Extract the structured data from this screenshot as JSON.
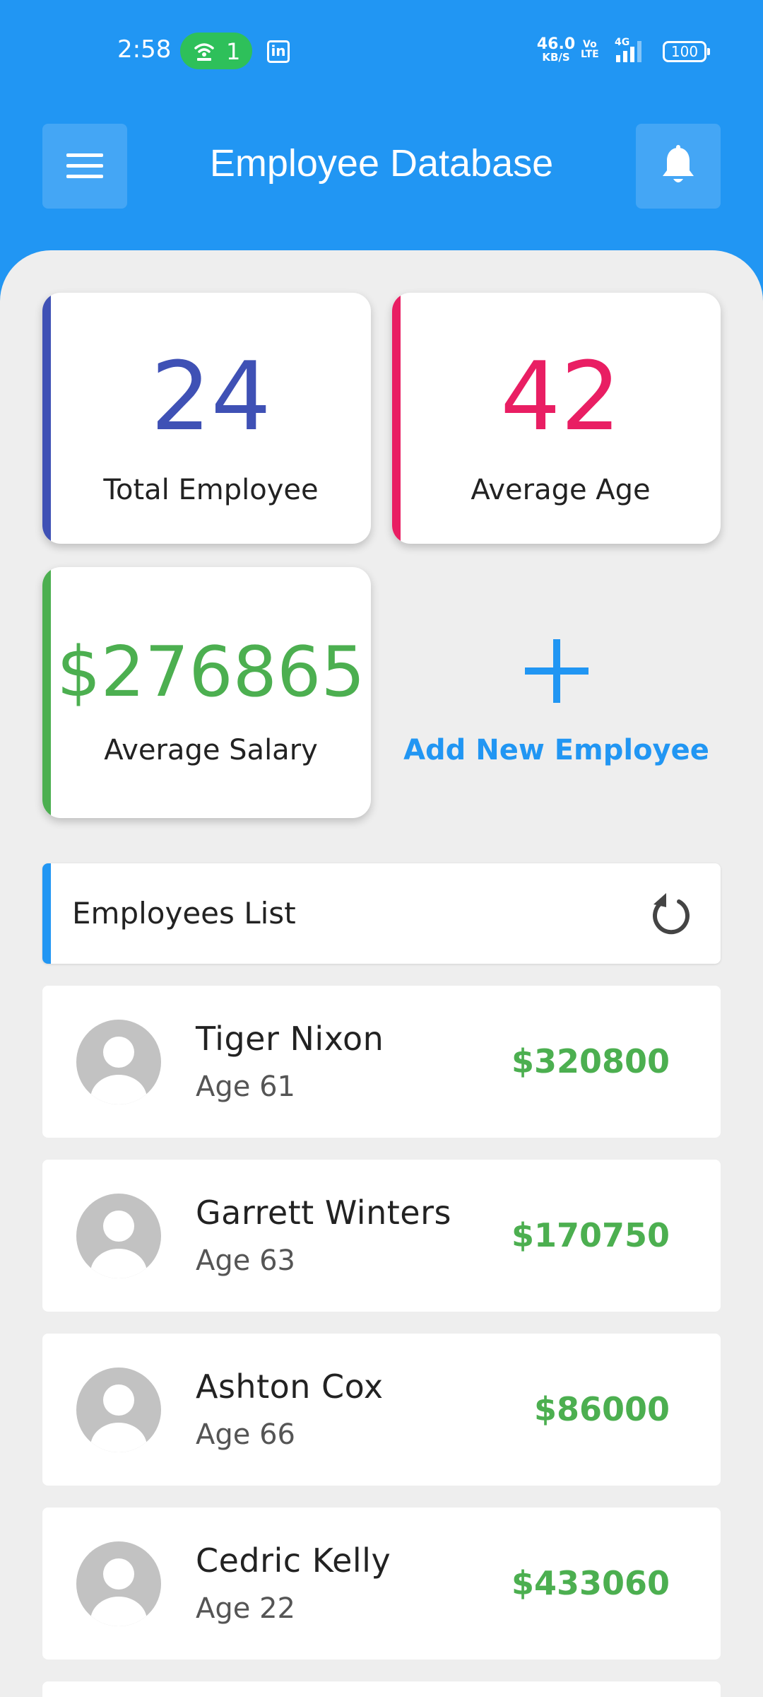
{
  "status_bar": {
    "time": "2:58",
    "hotspot_count": "1",
    "app_notification_icon": "linkedin-icon",
    "network_speed": "46.0",
    "network_speed_unit": "KB/S",
    "volte_top": "Vo",
    "volte_bottom": "LTE",
    "network_type": "4G",
    "battery": "100"
  },
  "app_bar": {
    "title": "Employee Database",
    "menu_icon": "hamburger-menu-icon",
    "notification_icon": "bell-icon"
  },
  "stats": {
    "total_employee": {
      "value": "24",
      "label": "Total Employee",
      "color": "#3f51b5"
    },
    "average_age": {
      "value": "42",
      "label": "Average Age",
      "color": "#e91e63"
    },
    "average_salary": {
      "value": "$276865",
      "label": "Average Salary",
      "color": "#4caf50"
    }
  },
  "add_employee": {
    "label": "Add New Employee",
    "icon": "plus-icon",
    "color": "#2196f3"
  },
  "employees_list": {
    "title": "Employees List",
    "refresh_icon": "refresh-icon",
    "items": [
      {
        "name": "Tiger Nixon",
        "age": "Age 61",
        "salary": "$320800"
      },
      {
        "name": "Garrett Winters",
        "age": "Age 63",
        "salary": "$170750"
      },
      {
        "name": "Ashton Cox",
        "age": "Age 66",
        "salary": "$86000"
      },
      {
        "name": "Cedric Kelly",
        "age": "Age 22",
        "salary": "$433060"
      }
    ]
  },
  "colors": {
    "primary": "#2196f3",
    "salary_green": "#4caf50",
    "background": "#eeeeee"
  }
}
